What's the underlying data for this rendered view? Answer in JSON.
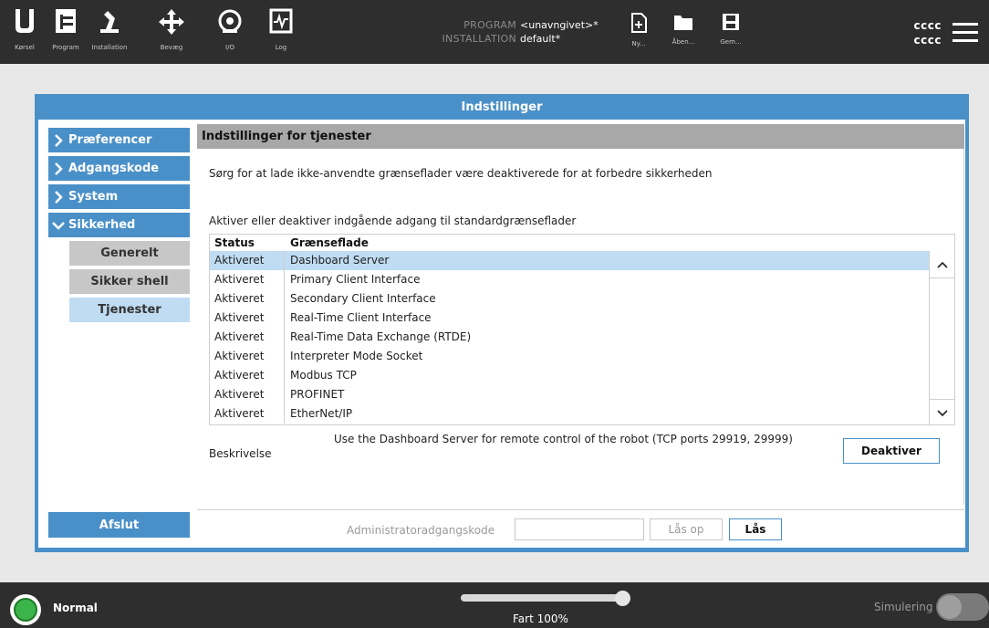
{
  "topbar": {
    "nav": [
      {
        "label": "Kørsel",
        "icon": "ur-logo-icon"
      },
      {
        "label": "Program",
        "icon": "program-icon"
      },
      {
        "label": "Installation",
        "icon": "robot-arm-icon"
      },
      {
        "label": "Bevæg",
        "icon": "move-arrows-icon"
      },
      {
        "label": "I/O",
        "icon": "io-icon"
      },
      {
        "label": "Log",
        "icon": "log-icon"
      }
    ],
    "program_key": "PROGRAM",
    "program_value": "<unavngivet>*",
    "installation_key": "INSTALLATION",
    "installation_value": "default*",
    "file_buttons": [
      {
        "label": "Ny...",
        "icon": "new-file-icon"
      },
      {
        "label": "Åben...",
        "icon": "folder-icon"
      },
      {
        "label": "Gem...",
        "icon": "save-icon"
      }
    ],
    "user_line1": "cccc",
    "user_line2": "cccc"
  },
  "dialog": {
    "title": "Indstillinger",
    "sidebar": {
      "items": [
        {
          "label": "Præferencer",
          "expanded": false
        },
        {
          "label": "Adgangskode",
          "expanded": false
        },
        {
          "label": "System",
          "expanded": false
        },
        {
          "label": "Sikkerhed",
          "expanded": true
        }
      ],
      "subitems": [
        {
          "label": "Generelt",
          "active": false
        },
        {
          "label": "Sikker shell",
          "active": false
        },
        {
          "label": "Tjenester",
          "active": true
        }
      ],
      "exit_label": "Afslut"
    },
    "panel": {
      "heading": "Indstillinger for tjenester",
      "info": "Sørg for at lade ikke-anvendte grænseflader være deaktiverede for at forbedre sikkerheden",
      "access_label": "Aktiver eller deaktiver indgående adgang til standardgrænseflader",
      "table": {
        "headers": [
          "Status",
          "Grænseflade"
        ],
        "rows": [
          {
            "status": "Aktiveret",
            "interface": "Dashboard Server",
            "selected": true
          },
          {
            "status": "Aktiveret",
            "interface": "Primary Client Interface",
            "selected": false
          },
          {
            "status": "Aktiveret",
            "interface": "Secondary Client Interface",
            "selected": false
          },
          {
            "status": "Aktiveret",
            "interface": "Real-Time Client Interface",
            "selected": false
          },
          {
            "status": "Aktiveret",
            "interface": "Real-Time Data Exchange (RTDE)",
            "selected": false
          },
          {
            "status": "Aktiveret",
            "interface": "Interpreter Mode Socket",
            "selected": false
          },
          {
            "status": "Aktiveret",
            "interface": "Modbus TCP",
            "selected": false
          },
          {
            "status": "Aktiveret",
            "interface": "PROFINET",
            "selected": false
          },
          {
            "status": "Aktiveret",
            "interface": "EtherNet/IP",
            "selected": false
          }
        ]
      },
      "description_label": "Beskrivelse",
      "description_text": "Use the Dashboard Server for remote control of the robot (TCP ports 29919, 29999)",
      "deactivate_label": "Deaktiver",
      "footer": {
        "admin_label": "Administratoradgangskode",
        "admin_value": "",
        "unlock_label": "Lås op",
        "lock_label": "Lås"
      }
    }
  },
  "bottombar": {
    "status": "Normal",
    "status_color": "#3bb54a",
    "speed_label": "Fart 100%",
    "speed_percent": 100,
    "simulation_label": "Simulering",
    "simulation_on": false
  },
  "colors": {
    "accent": "#4a90c8",
    "selected_row": "#bfdcf2",
    "topbar": "#2e2e2e"
  }
}
